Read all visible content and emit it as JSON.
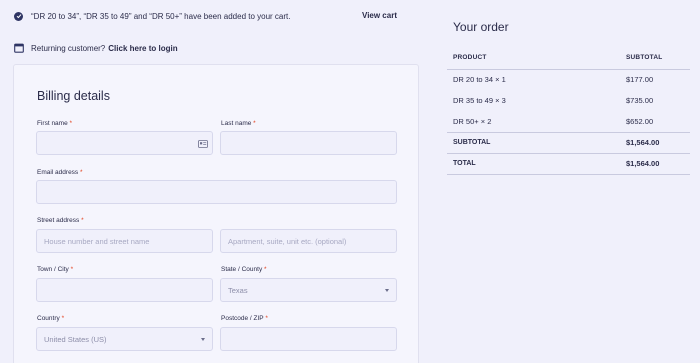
{
  "notice": {
    "message": "“DR 20 to 34”, “DR 35 to 49” and “DR 50+” have been added to your cart.",
    "view_cart": "View cart",
    "icon": "check-circle-icon"
  },
  "login": {
    "text": "Returning customer?",
    "link": "Click here to login",
    "icon": "calendar-icon"
  },
  "billing": {
    "title": "Billing details",
    "first_name": {
      "label": "First name",
      "value": "",
      "placeholder": ""
    },
    "last_name": {
      "label": "Last name",
      "value": "",
      "placeholder": ""
    },
    "email": {
      "label": "Email address",
      "value": "",
      "placeholder": ""
    },
    "street": {
      "label": "Street address",
      "placeholder1": "House number and street name",
      "placeholder2": "Apartment, suite, unit etc. (optional)"
    },
    "city": {
      "label": "Town / City",
      "value": "",
      "placeholder": ""
    },
    "state": {
      "label": "State / County",
      "selected": "Texas"
    },
    "country": {
      "label": "Country",
      "selected": "United States (US)"
    },
    "postcode": {
      "label": "Postcode / ZIP",
      "value": "",
      "placeholder": ""
    },
    "required_mark": "*"
  },
  "order": {
    "title": "Your order",
    "headers": {
      "product": "PRODUCT",
      "subtotal": "SUBTOTAL"
    },
    "items": [
      {
        "name": "DR 20 to 34",
        "qty": "× 1",
        "subtotal": "$177.00"
      },
      {
        "name": "DR 35 to 49",
        "qty": "× 3",
        "subtotal": "$735.00"
      },
      {
        "name": "DR 50+",
        "qty": "× 2",
        "subtotal": "$652.00"
      }
    ],
    "subtotal_label": "SUBTOTAL",
    "subtotal_value": "$1,564.00",
    "total_label": "TOTAL",
    "total_value": "$1,564.00"
  },
  "colors": {
    "background": "#f0f0fb",
    "text": "#2b2c4a",
    "required": "#e2401c",
    "border": "#d7d8ec"
  }
}
